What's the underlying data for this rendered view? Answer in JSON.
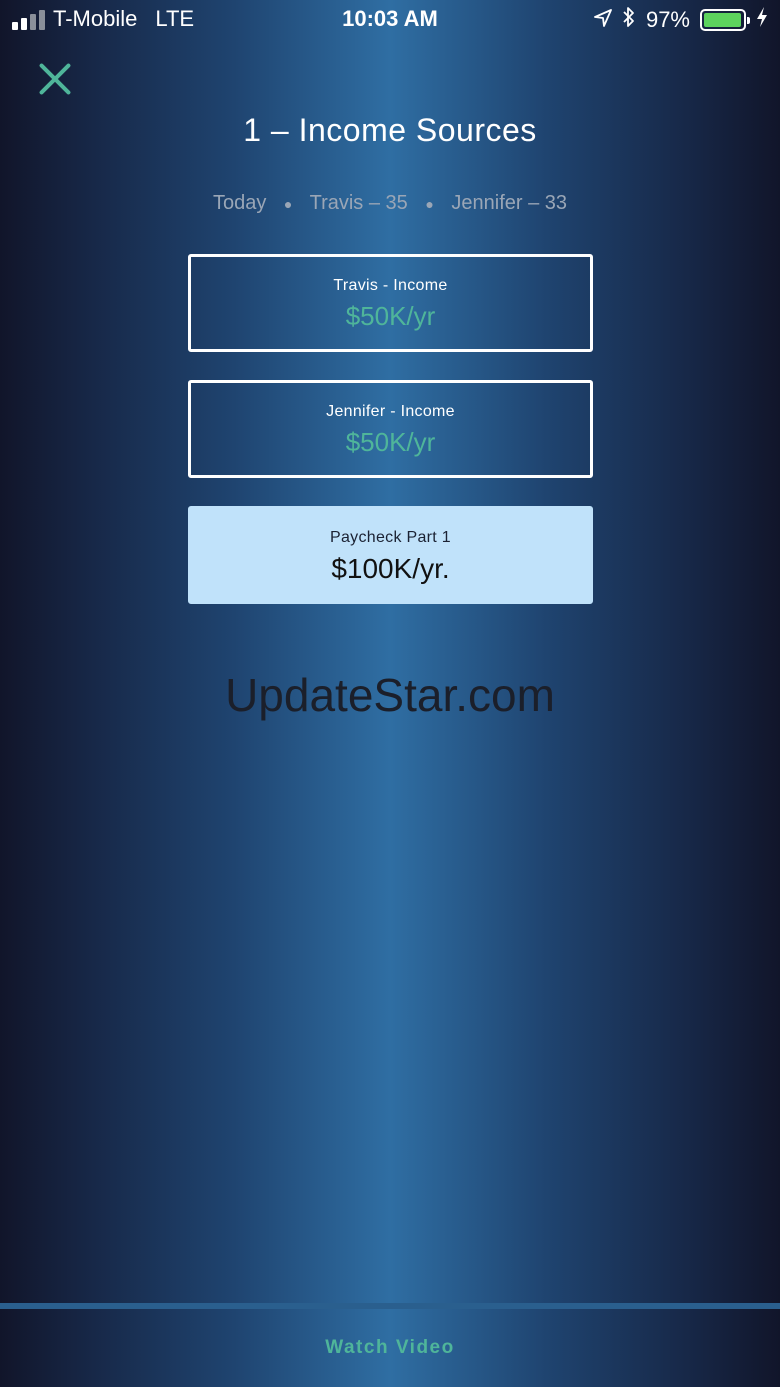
{
  "status_bar": {
    "carrier": "T-Mobile",
    "network": "LTE",
    "time": "10:03 AM",
    "battery": "97%",
    "battery_level": 0.97,
    "battery_color": "#5dd35d",
    "icons": [
      "signal-icon",
      "location-arrow-icon",
      "bluetooth-icon",
      "battery-icon",
      "charging-bolt-icon"
    ]
  },
  "header": {
    "close_icon": "close-icon",
    "title": "1 – Income Sources",
    "subtitle": {
      "today": "Today",
      "person1": "Travis – 35",
      "person2": "Jennifer – 33"
    }
  },
  "cards": {
    "travis": {
      "label": "Travis - Income",
      "value": "$50K/yr"
    },
    "jennifer": {
      "label": "Jennifer - Income",
      "value": "$50K/yr"
    },
    "total": {
      "label": "Paycheck Part 1",
      "value": "$100K/yr."
    }
  },
  "watermark": "UpdateStar.com",
  "footer": {
    "watch_video": "Watch Video"
  },
  "colors": {
    "accent": "#4fb59a",
    "highlight_card": "#c0e2fa"
  }
}
